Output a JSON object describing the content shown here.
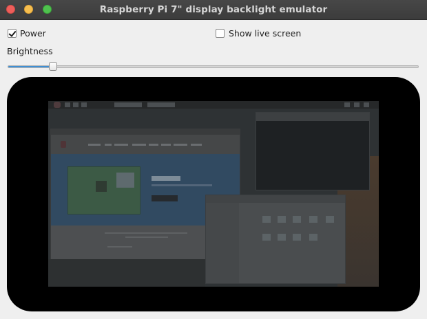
{
  "window": {
    "title": "Raspberry Pi 7\" display backlight emulator"
  },
  "controls": {
    "power": {
      "label": "Power",
      "checked": true
    },
    "live_screen": {
      "label": "Show live screen",
      "checked": false
    },
    "brightness": {
      "label": "Brightness",
      "value_fraction": 0.11
    }
  },
  "colors": {
    "titlebar": "#3c3c3c",
    "slider_fill": "#3f8fd3",
    "frame": "#000000"
  },
  "icons": {
    "close": "red-circle-icon",
    "minimize": "yellow-circle-icon",
    "maximize": "green-circle-icon"
  }
}
